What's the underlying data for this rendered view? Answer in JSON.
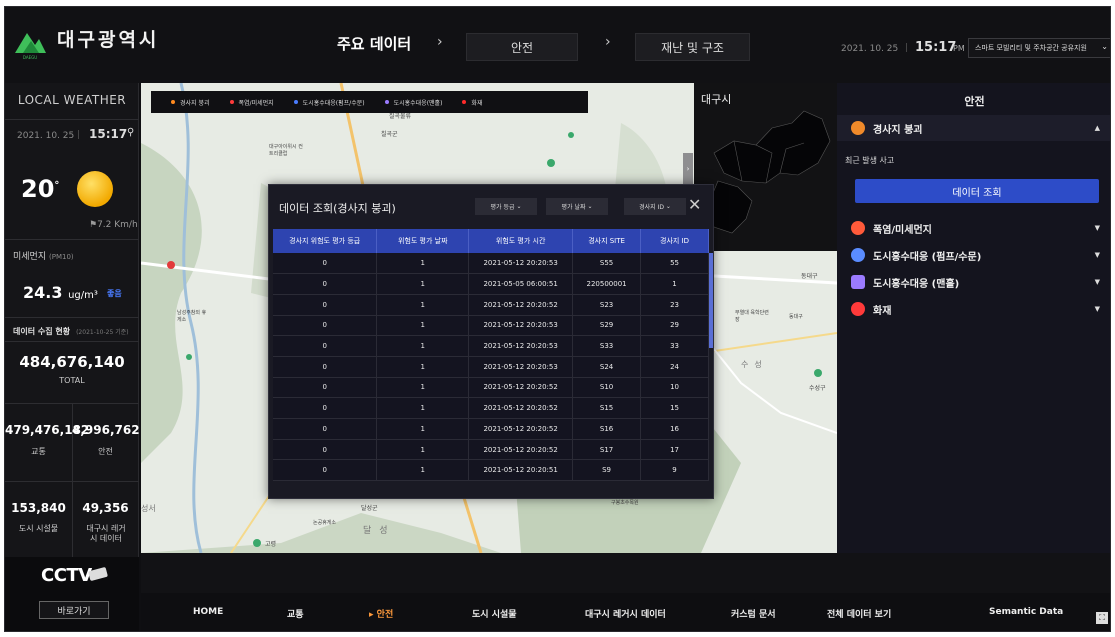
{
  "header": {
    "brand": "대구광역시",
    "logo_caption": "DAEGU",
    "title": "주요 데이터",
    "crumb1": "안전",
    "crumb2": "재난 및 구조",
    "date": "2021. 10. 25",
    "time": "15:17",
    "ampm": "PM",
    "select_value": "스마트 모빌리티 및 주차공간 공유지원"
  },
  "weather": {
    "title": "LOCAL WEATHER",
    "date": "2021. 10. 25",
    "time": "15:17",
    "temp": "20",
    "temp_unit": "°",
    "wind": "7.2 Km/h",
    "pm_label": "미세먼지",
    "pm_sub": "(PM10)",
    "pm_value": "24.3",
    "pm_unit": "ug/m³",
    "pm_status": "좋음",
    "collect_label": "데이터 수집 현황",
    "collect_date": "(2021-10-25 기준)",
    "total_value": "484,676,140",
    "total_label": "TOTAL",
    "stats": [
      {
        "value": "479,476,182",
        "label": "교통"
      },
      {
        "value": "4,996,762",
        "label": "안전"
      },
      {
        "value": "153,840",
        "label": "도시 시설물"
      },
      {
        "value": "49,356",
        "label": "대구시 레거시 데이터"
      }
    ]
  },
  "cctv": {
    "title": "CCTV",
    "button": "바로가기"
  },
  "map": {
    "legend": [
      {
        "label": "경사지 붕괴",
        "color": "#ff8a1f"
      },
      {
        "label": "폭염/미세먼지",
        "color": "#ff3b3b"
      },
      {
        "label": "도시홍수대응(펌프/수문)",
        "color": "#4a7cff"
      },
      {
        "label": "도시홍수대응(맨홀)",
        "color": "#9b7bff"
      },
      {
        "label": "화재",
        "color": "#ff2a2a"
      }
    ],
    "inset_label": "대구시"
  },
  "modal": {
    "title": "데이터 조회(경사지 붕괴)",
    "filters": [
      "평가 등급",
      "평가 날짜",
      "경사지 ID"
    ],
    "columns": [
      "경사지 위험도 평가 등급",
      "위험도 평가 날짜",
      "위험도 평가 시간",
      "경사지 SITE",
      "경사지 ID"
    ],
    "rows": [
      [
        "0",
        "1",
        "2021-05-12 20:20:53",
        "S55",
        "55"
      ],
      [
        "0",
        "1",
        "2021-05-05 06:00:51",
        "220500001",
        "1"
      ],
      [
        "0",
        "1",
        "2021-05-12 20:20:52",
        "S23",
        "23"
      ],
      [
        "0",
        "1",
        "2021-05-12 20:20:53",
        "S29",
        "29"
      ],
      [
        "0",
        "1",
        "2021-05-12 20:20:53",
        "S33",
        "33"
      ],
      [
        "0",
        "1",
        "2021-05-12 20:20:53",
        "S24",
        "24"
      ],
      [
        "0",
        "1",
        "2021-05-12 20:20:52",
        "S10",
        "10"
      ],
      [
        "0",
        "1",
        "2021-05-12 20:20:52",
        "S15",
        "15"
      ],
      [
        "0",
        "1",
        "2021-05-12 20:20:52",
        "S16",
        "16"
      ],
      [
        "0",
        "1",
        "2021-05-12 20:20:52",
        "S17",
        "17"
      ],
      [
        "0",
        "1",
        "2021-05-12 20:20:51",
        "S9",
        "9"
      ]
    ]
  },
  "right": {
    "title": "안전",
    "items": [
      {
        "label": "경사지 붕괴",
        "color": "#f08a2a",
        "arrow": "▲"
      },
      {
        "label": "폭염/미세먼지",
        "color": "#ff5a3a",
        "arrow": "▼"
      },
      {
        "label": "도시홍수대응 (펌프/수문)",
        "color": "#5a8cff",
        "arrow": "▼"
      },
      {
        "label": "도시홍수대응 (맨홀)",
        "color": "#9b7bff",
        "arrow": "▼"
      },
      {
        "label": "화재",
        "color": "#ff3a3a",
        "arrow": "▼"
      }
    ],
    "sub_label": "최근 발생 사고",
    "button": "데이터 조회"
  },
  "nav": {
    "items": [
      "HOME",
      "교통",
      "안전",
      "도시 시설물",
      "대구시 레거시 데이터",
      "커스텀 문서",
      "전체 데이터 보기",
      "Semantic Data"
    ],
    "active_marker": "▸"
  },
  "map_labels": [
    "칠곡물류",
    "칠곡군",
    "대구아이위시 컨트리클럽",
    "남성주참외 휴게소",
    "동대구",
    "무열대 육학단련장",
    "동대구",
    "수성",
    "수성구",
    "달성군",
    "논공휴게소",
    "달성",
    "성서",
    "고령",
    "구봉초수목원"
  ]
}
